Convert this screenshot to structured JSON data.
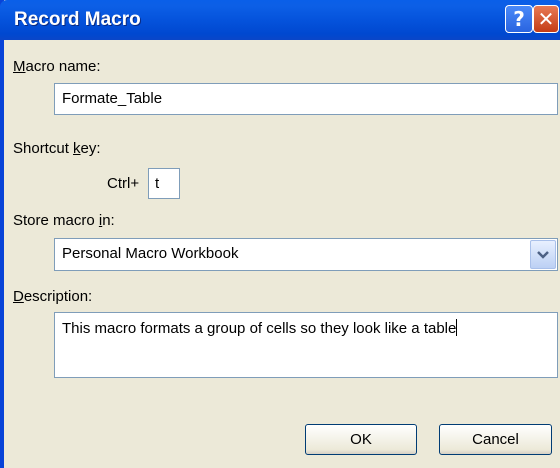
{
  "window": {
    "title": "Record Macro",
    "help_glyph": "?",
    "close_glyph": "✕"
  },
  "macro_name": {
    "label_underlined": "M",
    "label_rest": "acro name:",
    "value": "Formate_Table"
  },
  "shortcut": {
    "label_prefix": "Shortcut ",
    "label_underlined": "k",
    "label_suffix": "ey:",
    "modifier": "Ctrl+",
    "value": "t"
  },
  "store": {
    "label_prefix": "Store macro ",
    "label_underlined": "i",
    "label_suffix": "n:",
    "value": "Personal Macro Workbook",
    "arrow_icon": "chevron-down-icon"
  },
  "description": {
    "label_underlined": "D",
    "label_rest": "escription:",
    "value": "This macro formats a group of cells so they look like a table"
  },
  "buttons": {
    "ok": "OK",
    "cancel": "Cancel"
  },
  "colors": {
    "titlebar": "#0553dc",
    "dialog_bg": "#ece9d8",
    "field_border": "#7f9db9"
  }
}
